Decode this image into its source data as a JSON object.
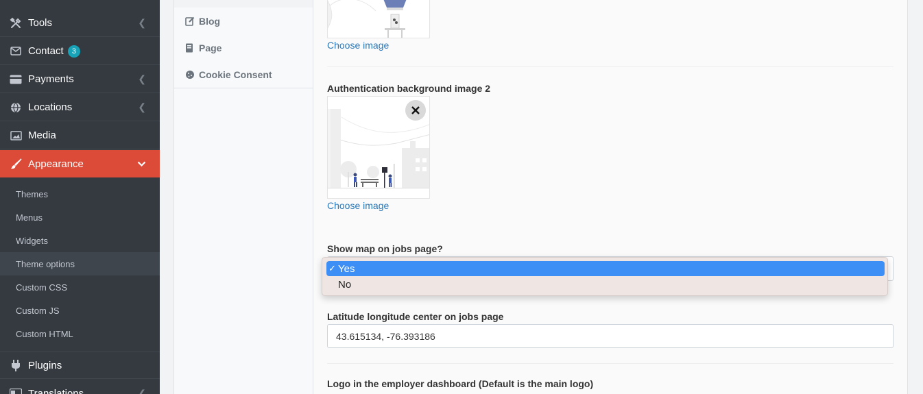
{
  "sidebar": {
    "items": [
      {
        "label": "Tools",
        "icon": "tools-icon"
      },
      {
        "label": "Contact",
        "icon": "envelope-icon",
        "badge": "3"
      },
      {
        "label": "Payments",
        "icon": "credit-card-icon"
      },
      {
        "label": "Locations",
        "icon": "globe-icon"
      },
      {
        "label": "Media",
        "icon": "image-icon"
      },
      {
        "label": "Appearance",
        "icon": "paintbrush-icon"
      },
      {
        "label": "Plugins",
        "icon": "plug-icon"
      },
      {
        "label": "Translations",
        "icon": "language-icon"
      }
    ],
    "appearance_sub": [
      "Themes",
      "Menus",
      "Widgets",
      "Theme options",
      "Custom CSS",
      "Custom JS",
      "Custom HTML"
    ],
    "active_color": "#dc4a38"
  },
  "theme_menu": {
    "items": [
      {
        "label": "Blog",
        "icon": "edit-icon"
      },
      {
        "label": "Page",
        "icon": "book-icon"
      },
      {
        "label": "Cookie Consent",
        "icon": "cookie-icon"
      }
    ]
  },
  "form": {
    "choose_image_1": "Choose image",
    "auth_bg_2_label": "Authentication background image 2",
    "choose_image_2": "Choose image",
    "show_map_label": "Show map on jobs page?",
    "show_map_options": [
      "Yes",
      "No"
    ],
    "show_map_selected": "Yes",
    "check_mark": "✓",
    "latlng_label": "Latitude longitude center on jobs page",
    "latlng_value": "43.615134, -76.393186",
    "employer_logo_label": "Logo in the employer dashboard (Default is the main logo)"
  }
}
